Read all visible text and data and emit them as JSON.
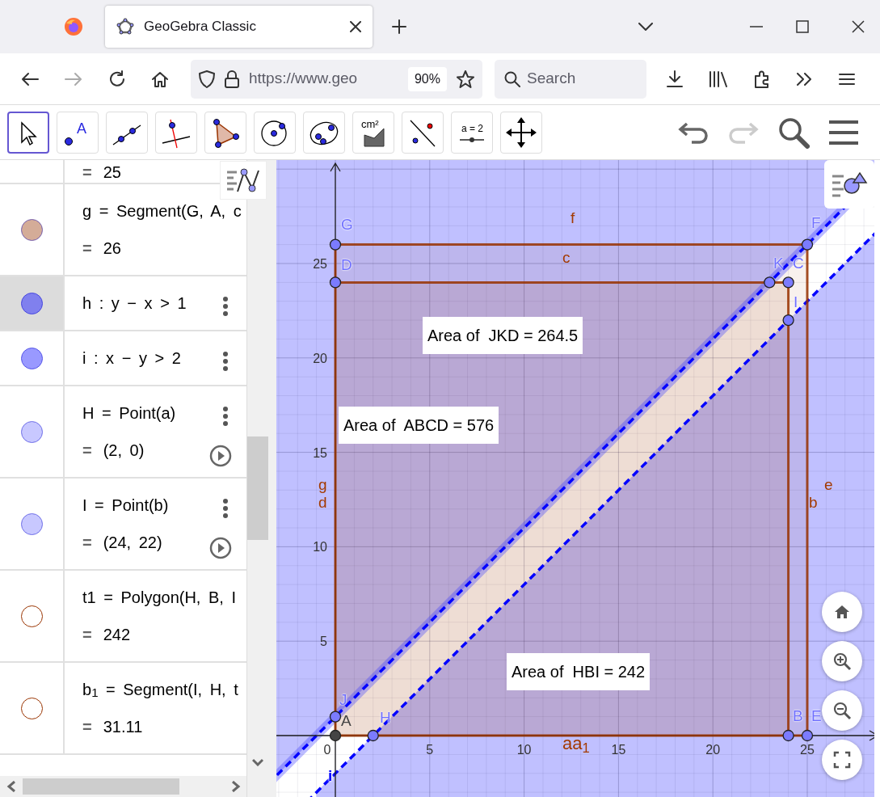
{
  "browser": {
    "tab_title": "GeoGebra Classic",
    "url": "https://www.geo",
    "zoom": "90%",
    "search_placeholder": "Search"
  },
  "tools": [
    {
      "kind": "move",
      "selected": true
    },
    {
      "kind": "point",
      "text": "A",
      "selected": false
    },
    {
      "kind": "line",
      "selected": false
    },
    {
      "kind": "perpendicular",
      "selected": false
    },
    {
      "kind": "polygon",
      "selected": false
    },
    {
      "kind": "circle",
      "selected": false
    },
    {
      "kind": "conic",
      "selected": false
    },
    {
      "kind": "area",
      "text": "cm²",
      "selected": false
    },
    {
      "kind": "reflect",
      "selected": false
    },
    {
      "kind": "slider",
      "text": "a = 2",
      "selected": false
    },
    {
      "kind": "move-view",
      "selected": false
    }
  ],
  "algebra": [
    {
      "kind": "none",
      "selected": false,
      "equals": "=",
      "value": "25"
    },
    {
      "kind": "filled",
      "color": "#d4ac98",
      "selected": false,
      "definition": "g = Segment(G, A, c",
      "equals": "=",
      "value": "26",
      "menu": false,
      "play": false
    },
    {
      "kind": "filled",
      "color": "#8080ee",
      "selected": true,
      "definition": "h : y − x > 1",
      "menu": true,
      "play": false
    },
    {
      "kind": "filled",
      "color": "#9999ff",
      "selected": false,
      "definition": "i : x − y > 2",
      "menu": true,
      "play": false
    },
    {
      "kind": "filled",
      "color": "#c8c8ff",
      "selected": false,
      "definition": "H = Point(a)",
      "equals": "=",
      "value": "(2, 0)",
      "menu": true,
      "play": true
    },
    {
      "kind": "filled",
      "color": "#c8c8ff",
      "selected": false,
      "definition": "I = Point(b)",
      "equals": "=",
      "value": "(24, 22)",
      "menu": true,
      "play": true
    },
    {
      "kind": "outline",
      "color": "#993300",
      "selected": false,
      "definition": "t1 = Polygon(H, B, I",
      "equals": "=",
      "value": "242",
      "menu": false,
      "play": false
    },
    {
      "kind": "outline",
      "color": "#993300",
      "selected": false,
      "definition": "b$_{1}$ = Segment(I, H, t",
      "equals": "=",
      "value": "31.11",
      "menu": false,
      "play": false
    }
  ],
  "graph": {
    "points": [
      {
        "label": "G",
        "kind": "point"
      },
      {
        "label": "D",
        "kind": "point"
      },
      {
        "label": "F",
        "kind": "point"
      },
      {
        "label": "K",
        "kind": "point"
      },
      {
        "label": "C",
        "kind": "point"
      },
      {
        "label": "I",
        "kind": "point"
      },
      {
        "label": "J",
        "kind": "point"
      },
      {
        "label": "A",
        "kind": "fixed"
      },
      {
        "label": "H",
        "kind": "point"
      },
      {
        "label": "B",
        "kind": "point"
      },
      {
        "label": "E",
        "kind": "point"
      }
    ],
    "object_labels": [
      "f",
      "c",
      "g",
      "d",
      "e",
      "b",
      "aa$_{1}$",
      "i"
    ],
    "x_ticks": [
      "0",
      "5",
      "10",
      "15",
      "20",
      "25"
    ],
    "y_ticks": [
      "25",
      "20",
      "15",
      "10",
      "5"
    ],
    "text_boxes": [
      "Area of  JKD = 264.5",
      "Area of  ABCD = 576",
      "Area of  HBI = 242"
    ]
  }
}
